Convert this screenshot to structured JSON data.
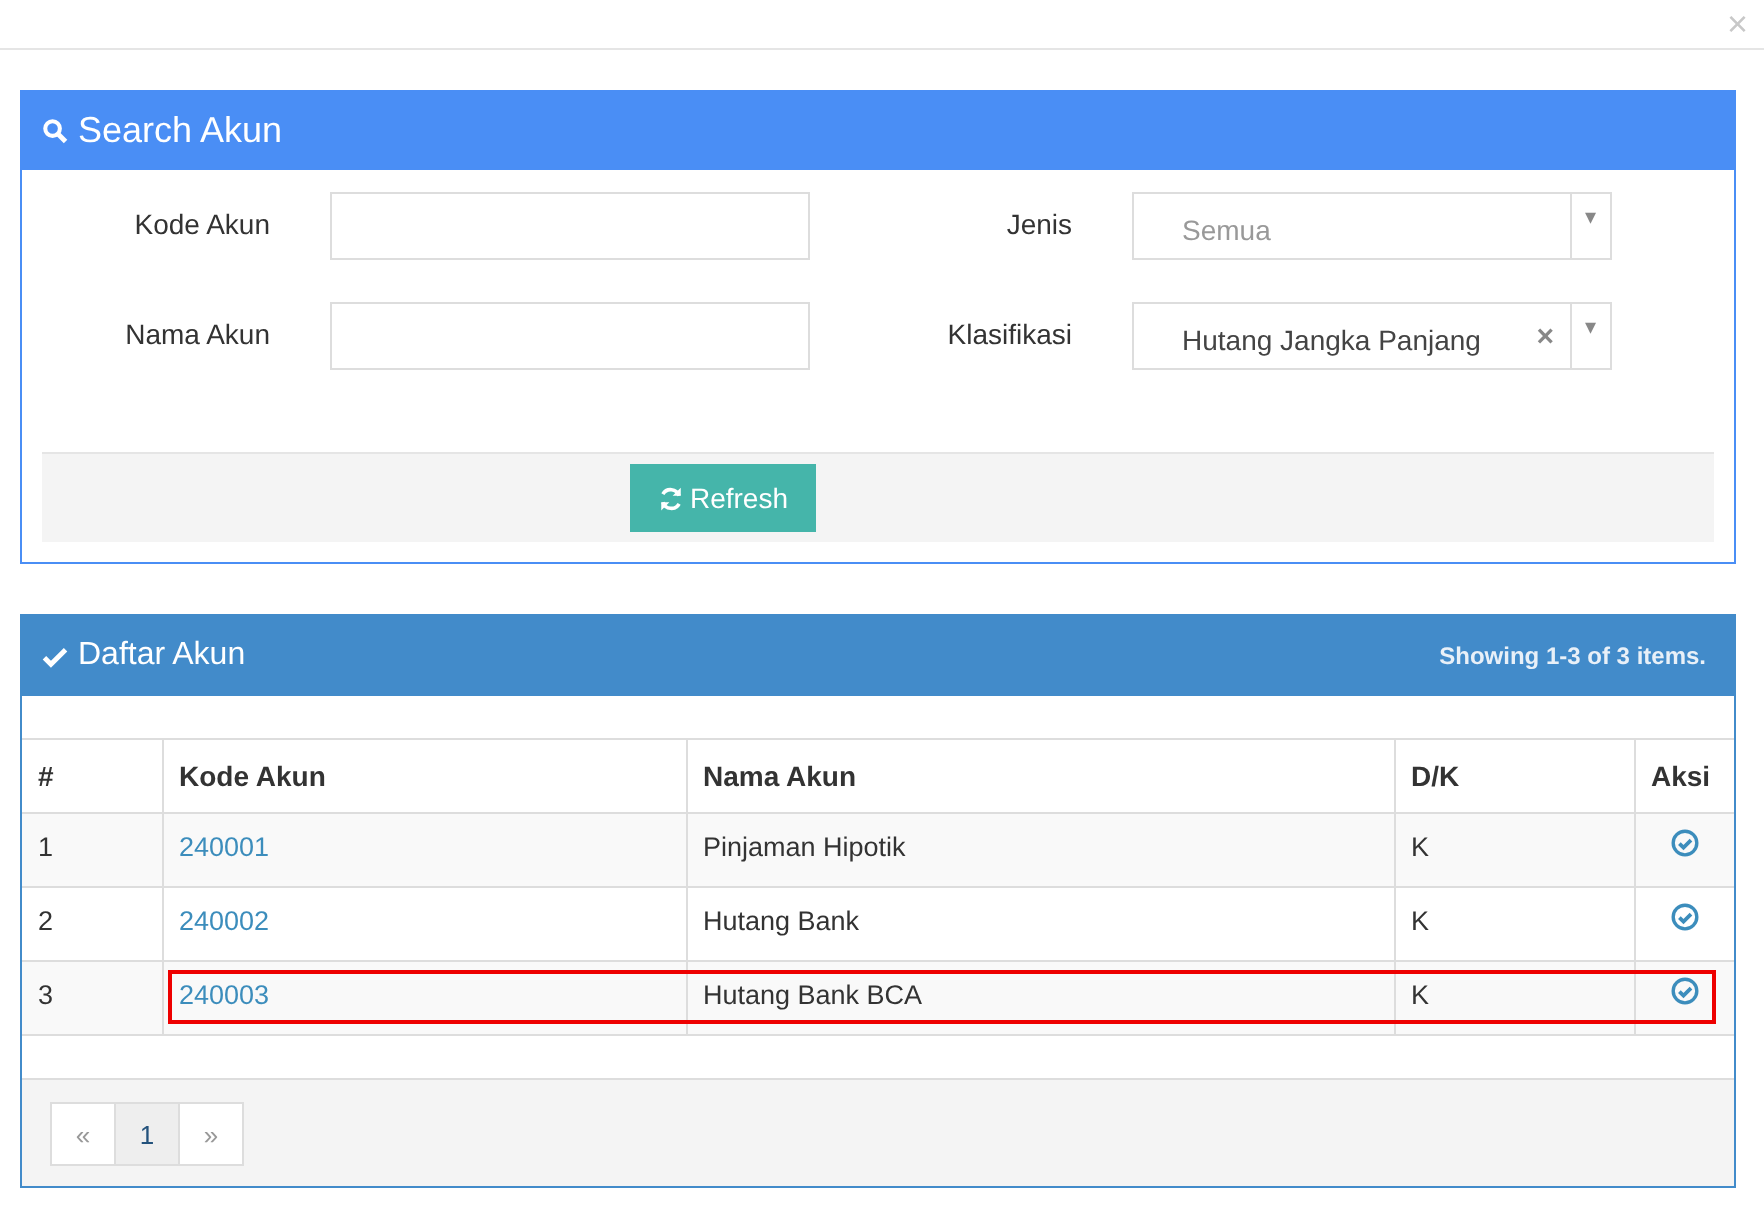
{
  "dialog": {
    "close": "×"
  },
  "search_panel": {
    "title": "Search Akun",
    "fields": [
      {
        "label": "Kode Akun",
        "kind": "text"
      },
      {
        "label": "Jenis",
        "kind": "select",
        "value": "Semua",
        "placeholder_style": true,
        "clearable": false
      },
      {
        "label": "Nama Akun",
        "kind": "text"
      },
      {
        "label": "Klasifikasi",
        "kind": "select",
        "value": "Hutang Jangka Panjang",
        "placeholder_style": false,
        "clearable": true
      }
    ],
    "clear": "×",
    "dropdown": "▾",
    "refresh_button": "Refresh"
  },
  "list_panel": {
    "title": "Daftar Akun",
    "summary": "Showing 1-3 of 3 items.",
    "columns": [
      "#",
      "Kode Akun",
      "Nama Akun",
      "D/K",
      "Aksi"
    ],
    "rows": [
      {
        "no": "1",
        "kode": "240001",
        "nama": "Pinjaman Hipotik",
        "dk": "K",
        "highlighted": false
      },
      {
        "no": "2",
        "kode": "240002",
        "nama": "Hutang Bank",
        "dk": "K",
        "highlighted": false
      },
      {
        "no": "3",
        "kode": "240003",
        "nama": "Hutang Bank BCA",
        "dk": "K",
        "highlighted": true
      }
    ],
    "pagination": [
      {
        "label": "«",
        "selected": false
      },
      {
        "label": "1",
        "selected": true
      },
      {
        "label": "»",
        "selected": false
      }
    ]
  }
}
